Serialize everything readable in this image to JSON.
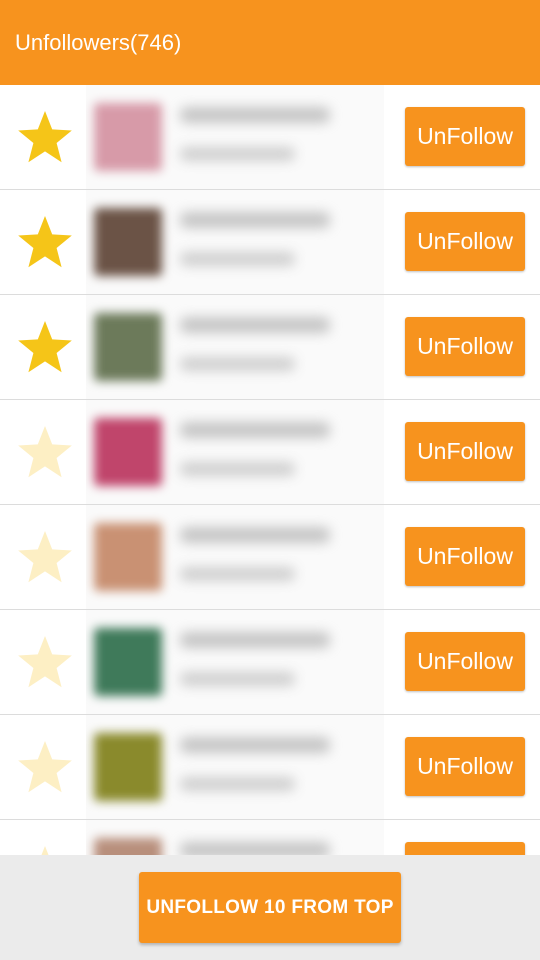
{
  "header": {
    "title": "Unfollowers(746)"
  },
  "colors": {
    "accent": "#F7931E",
    "star_active": "#F5C518",
    "star_inactive": "#FDEFC4"
  },
  "list": {
    "button_label": "UnFollow",
    "rows": [
      {
        "starred": true,
        "icon": "star-icon",
        "avatar_color": "#d79aa8"
      },
      {
        "starred": true,
        "icon": "star-icon",
        "avatar_color": "#6b5346"
      },
      {
        "starred": true,
        "icon": "star-icon",
        "avatar_color": "#6c7a5a"
      },
      {
        "starred": false,
        "icon": "star-icon",
        "avatar_color": "#c0456b"
      },
      {
        "starred": false,
        "icon": "star-icon",
        "avatar_color": "#c99173"
      },
      {
        "starred": false,
        "icon": "star-icon",
        "avatar_color": "#3f7a5a"
      },
      {
        "starred": false,
        "icon": "star-icon",
        "avatar_color": "#8a8a2c"
      },
      {
        "starred": false,
        "icon": "star-icon",
        "avatar_color": "#b88f7c"
      }
    ]
  },
  "footer": {
    "bulk_label": "UNFOLLOW 10 FROM TOP"
  }
}
